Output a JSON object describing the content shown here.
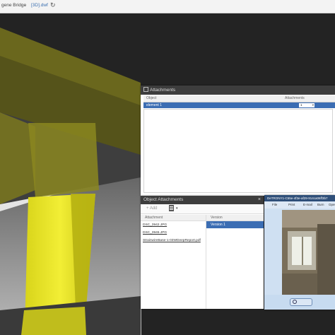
{
  "topbar": {
    "crumb1": "gene Bridge",
    "separator": "›",
    "crumb2": "[3D].dwf",
    "refresh_icon": "↻"
  },
  "attachments_window": {
    "title": "Attachments",
    "col_object": "Object",
    "col_attachments": "Attachments",
    "row": {
      "name": "element 1",
      "count": "1"
    }
  },
  "object_attachments": {
    "title": "Object Attachments",
    "close": "×",
    "add_label": "+ Add",
    "doc_dropdown": "▾",
    "col_attachment": "Attachment",
    "col_version": "Version",
    "items": [
      "DSC_3942.JPG",
      "DSC_3945.JPG",
      "StrainwireBase-1-03WDeepReport.pdf"
    ],
    "selected_version": "Version 1"
  },
  "photo_viewer": {
    "title": "DeTRONY1-C55e-4f3e-af29-914ca06ff3b7",
    "menu": [
      "File",
      "Print",
      "E-mail",
      "Burn",
      "Open"
    ]
  },
  "colors": {
    "column_fill": "#e6e320",
    "shadow_fill": "#4a4a12",
    "selection": "#3b6db3"
  }
}
